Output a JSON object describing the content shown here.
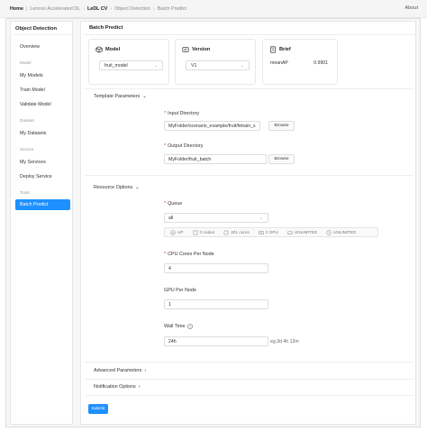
{
  "breadcrumb": {
    "home": "Home",
    "items": [
      "Lenovo Accelerated DL",
      "LeDL CV",
      "Object Detection",
      "Batch Predict"
    ]
  },
  "header": {
    "about": "About"
  },
  "sidebar": {
    "title": "Object Detection",
    "overview": "Overview",
    "section_model": "Model",
    "my_models": "My Models",
    "train_model": "Train Model",
    "validate_model": "Validate Model",
    "section_dataset": "Dataset",
    "my_datasets": "My Datasets",
    "section_service": "Service",
    "my_services": "My Services",
    "deploy_service": "Deploy Service",
    "section_tools": "Tools",
    "batch_predict": "Batch Predict"
  },
  "main": {
    "title": "Batch Predict",
    "model_card": {
      "label": "Model",
      "value": "fruit_model"
    },
    "version_card": {
      "label": "Version",
      "value": "V1"
    },
    "brief_card": {
      "label": "Brief",
      "key": "meanAP",
      "value": "0.9901"
    },
    "template_params": "Template Parameters",
    "input_dir_label": "Input Directory",
    "input_dir_value": "MyFolder/scenario_example/fruit/fetrain_s",
    "output_dir_label": "Output Directory",
    "output_dir_value": "MyFolder/fruit_batch",
    "browse": "Browse",
    "resource_options": "Resource Options",
    "queue_label": "Queue",
    "queue_value": "all",
    "queue_info": {
      "status": "UP",
      "nodes": "3 nodes",
      "cores": "201 cores",
      "gpu": "3 GPU",
      "mem": "UNLIMITED",
      "time": "UNLIMITED"
    },
    "cpu_label": "CPU Cores Per Node",
    "cpu_value": "4",
    "gpu_label": "GPU Per Node",
    "gpu_value": "1",
    "walltime_label": "Wall Time",
    "walltime_value": "24h",
    "walltime_hint": "eg.3d 4h 12m",
    "advanced_params": "Advanced Parameters",
    "notification_options": "Notification Options",
    "submit": "Submit"
  },
  "colors": {
    "accent": "#1e90ff",
    "required": "#e53935"
  }
}
